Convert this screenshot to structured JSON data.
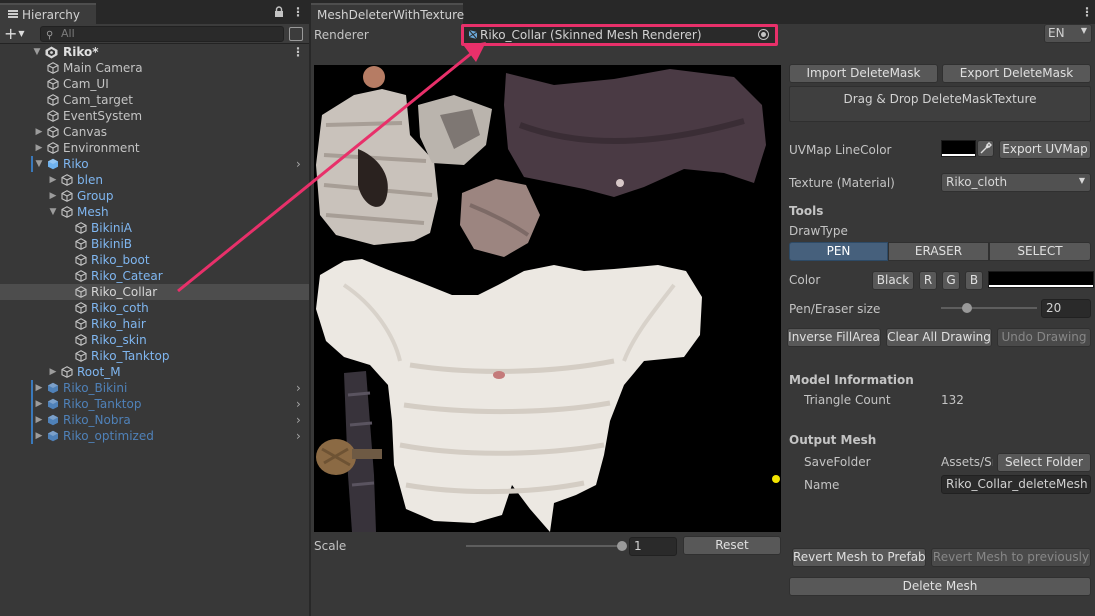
{
  "hierarchy": {
    "tab_label": "Hierarchy",
    "search_placeholder": "All",
    "add_label": "+",
    "root": "Riko*",
    "items": [
      {
        "label": "Main Camera",
        "icon": "gameobject-icon",
        "depth": 1,
        "arrow": "",
        "color": "#c4c4c4",
        "prefab": false
      },
      {
        "label": "Cam_UI",
        "icon": "gameobject-icon",
        "depth": 1,
        "arrow": "",
        "color": "#c4c4c4",
        "prefab": false
      },
      {
        "label": "Cam_target",
        "icon": "gameobject-icon",
        "depth": 1,
        "arrow": "",
        "color": "#c4c4c4",
        "prefab": false
      },
      {
        "label": "EventSystem",
        "icon": "gameobject-icon",
        "depth": 1,
        "arrow": "",
        "color": "#c4c4c4",
        "prefab": false
      },
      {
        "label": "Canvas",
        "icon": "gameobject-icon",
        "depth": 1,
        "arrow": "collapsed",
        "color": "#c4c4c4",
        "prefab": false
      },
      {
        "label": "Environment",
        "icon": "gameobject-icon",
        "depth": 1,
        "arrow": "collapsed",
        "color": "#c4c4c4",
        "prefab": false
      },
      {
        "label": "Riko",
        "icon": "prefab-icon",
        "depth": 1,
        "arrow": "expanded",
        "color": "#7fb6f0",
        "prefab": true,
        "chevron": true
      },
      {
        "label": "blen",
        "icon": "prefab-child-icon",
        "depth": 2,
        "arrow": "collapsed",
        "color": "#7fb6f0",
        "prefab": false
      },
      {
        "label": "Group",
        "icon": "prefab-child-icon",
        "depth": 2,
        "arrow": "collapsed",
        "color": "#7fb6f0",
        "prefab": false
      },
      {
        "label": "Mesh",
        "icon": "prefab-child-icon",
        "depth": 2,
        "arrow": "expanded",
        "color": "#7fb6f0",
        "prefab": false
      },
      {
        "label": "BikiniA",
        "icon": "prefab-child-icon",
        "depth": 3,
        "arrow": "",
        "color": "#7fb6f0",
        "prefab": false
      },
      {
        "label": "BikiniB",
        "icon": "prefab-child-icon",
        "depth": 3,
        "arrow": "",
        "color": "#7fb6f0",
        "prefab": false
      },
      {
        "label": "Riko_boot",
        "icon": "prefab-child-icon",
        "depth": 3,
        "arrow": "",
        "color": "#7fb6f0",
        "prefab": false
      },
      {
        "label": "Riko_Catear",
        "icon": "prefab-child-icon",
        "depth": 3,
        "arrow": "",
        "color": "#7fb6f0",
        "prefab": false
      },
      {
        "label": "Riko_Collar",
        "icon": "prefab-child-icon",
        "depth": 3,
        "arrow": "",
        "color": "#d6d6d6",
        "prefab": false,
        "selected": true
      },
      {
        "label": "Riko_coth",
        "icon": "prefab-child-icon",
        "depth": 3,
        "arrow": "",
        "color": "#7fb6f0",
        "prefab": false
      },
      {
        "label": "Riko_hair",
        "icon": "prefab-child-icon",
        "depth": 3,
        "arrow": "",
        "color": "#7fb6f0",
        "prefab": false
      },
      {
        "label": "Riko_skin",
        "icon": "prefab-child-icon",
        "depth": 3,
        "arrow": "",
        "color": "#7fb6f0",
        "prefab": false
      },
      {
        "label": "Riko_Tanktop",
        "icon": "prefab-child-icon",
        "depth": 3,
        "arrow": "",
        "color": "#7fb6f0",
        "prefab": false
      },
      {
        "label": "Root_M",
        "icon": "prefab-child-icon",
        "depth": 2,
        "arrow": "collapsed",
        "color": "#7fb6f0",
        "prefab": false
      },
      {
        "label": "Riko_Bikini",
        "icon": "prefab-icon",
        "depth": 1,
        "arrow": "collapsed",
        "color": "#4f81b8",
        "prefab": true,
        "chevron": true
      },
      {
        "label": "Riko_Tanktop",
        "icon": "prefab-icon",
        "depth": 1,
        "arrow": "collapsed",
        "color": "#4f81b8",
        "prefab": true,
        "chevron": true
      },
      {
        "label": "Riko_Nobra",
        "icon": "prefab-icon",
        "depth": 1,
        "arrow": "collapsed",
        "color": "#4f81b8",
        "prefab": true,
        "chevron": true
      },
      {
        "label": "Riko_optimized",
        "icon": "prefab-icon",
        "depth": 1,
        "arrow": "collapsed",
        "color": "#4f81b8",
        "prefab": true,
        "chevron": true
      }
    ]
  },
  "window": {
    "tab_label": "MeshDeleterWithTexture",
    "renderer_label": "Renderer",
    "renderer_value": "Riko_Collar (Skinned Mesh Renderer)",
    "language": "EN",
    "scale_label": "Scale",
    "scale_value": "1",
    "scale_level": 1.0,
    "reset_label": "Reset"
  },
  "panel": {
    "import_mask": "Import DeleteMask",
    "export_mask": "Export DeleteMask",
    "drop_zone": "Drag & Drop DeleteMaskTexture",
    "uvmap_line_color_label": "UVMap LineColor",
    "export_uvmap": "Export UVMap",
    "texture_label": "Texture (Material)",
    "texture_value": "Riko_cloth",
    "tools_header": "Tools",
    "draw_type_label": "DrawType",
    "draw_types": [
      "PEN",
      "ERASER",
      "SELECT"
    ],
    "active_draw_type": "PEN",
    "color_label": "Color",
    "color_buttons": [
      "Black",
      "R",
      "G",
      "B"
    ],
    "pen_size_label": "Pen/Eraser size",
    "pen_size_value": "20",
    "pen_size_level": 0.1,
    "inverse_fill": "Inverse FillArea",
    "clear_drawing": "Clear All Drawing",
    "undo_drawing": "Undo Drawing",
    "model_info_header": "Model Information",
    "triangle_count_label": "Triangle Count",
    "triangle_count_value": "132",
    "output_header": "Output Mesh",
    "save_folder_label": "SaveFolder",
    "save_folder_value": "Assets/Sı",
    "select_folder": "Select Folder",
    "name_label": "Name",
    "name_value": "Riko_Collar_deleteMesh",
    "revert_prefab": "Revert Mesh to Prefab",
    "revert_previous": "Revert Mesh to previously",
    "delete_mesh": "Delete Mesh"
  },
  "colors": {
    "highlight": "#e8306a",
    "prefab_blue": "#7fb6f0",
    "prefab_dim_blue": "#4f81b8",
    "active_segment": "#46607c"
  }
}
